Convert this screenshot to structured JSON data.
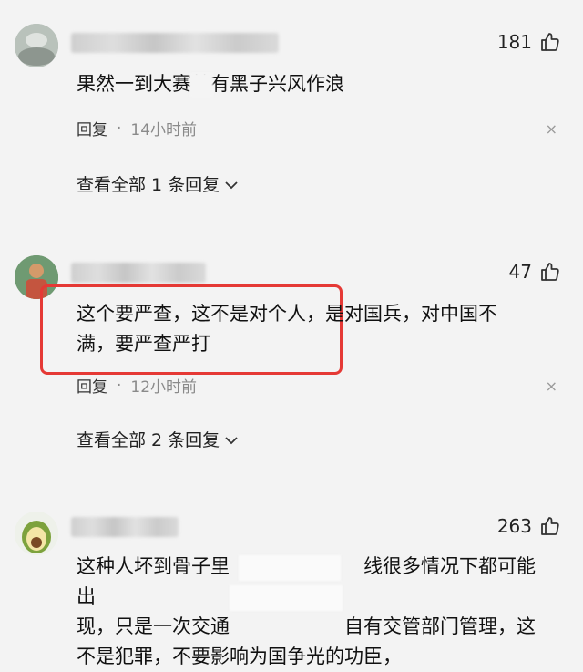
{
  "comments": [
    {
      "likes": "181",
      "text": "果然一到大赛就有黑子兴风作浪",
      "reply_label": "回复",
      "dot": "·",
      "time": "14小时前",
      "view_replies": "查看全部 1 条回复",
      "close_symbol": "×"
    },
    {
      "likes": "47",
      "text_line1": "这个要严查，这不是对个人，是对国兵，对中国不",
      "text_line2": "满，要严查严打",
      "reply_label": "回复",
      "dot": "·",
      "time": "12小时前",
      "view_replies": "查看全部 2 条回复",
      "close_symbol": "×"
    },
    {
      "likes": "263",
      "text_line1": "这种人坏到骨子里　　　　　　　线很多情况下都可能出",
      "text_line2": "现，只是一次交通　　　　　　自有交管部门管理，这",
      "text_line3": "不是犯罪，不要影响为国争光的功臣，"
    }
  ],
  "icons": {
    "like": "thumbs-up-icon",
    "expand": "chevron-down-icon",
    "close": "close-icon"
  },
  "colors": {
    "background": "#f3f3f3",
    "highlight": "#e53935"
  }
}
